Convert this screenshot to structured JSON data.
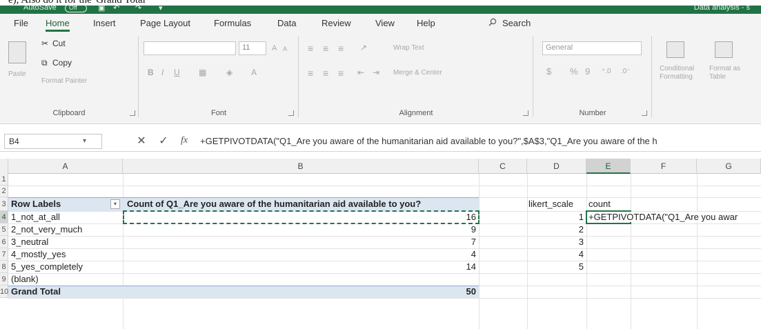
{
  "caption": "e), Also do it for the 'Grand Total'",
  "titlebar": {
    "autosave": "AutoSave",
    "autosave_state": "Off",
    "document_title": "Data analysis - s"
  },
  "tabs": [
    "File",
    "Home",
    "Insert",
    "Page Layout",
    "Formulas",
    "Data",
    "Review",
    "View",
    "Help"
  ],
  "search_label": "Search",
  "ribbon": {
    "clipboard": {
      "paste": "Paste",
      "cut": "Cut",
      "copy": "Copy",
      "format_painter": "Format Painter",
      "label": "Clipboard"
    },
    "font": {
      "size": "11",
      "grow": "A",
      "shrink": "A",
      "bold": "B",
      "italic": "I",
      "underline": "U",
      "label": "Font"
    },
    "alignment": {
      "wrap_text": "Wrap Text",
      "merge_center": "Merge & Center",
      "label": "Alignment"
    },
    "number": {
      "format": "General",
      "currency": "$",
      "percent": "%",
      "comma": "9",
      "label": "Number"
    },
    "styles": {
      "conditional": "Conditional Formatting",
      "format_as_table": "Format as Table"
    }
  },
  "formula_bar": {
    "name_box": "B4",
    "formula": "+GETPIVOTDATA(\"Q1_Are you aware of the humanitarian aid available to you?\",$A$3,\"Q1_Are you aware of the h"
  },
  "sheet": {
    "columns": [
      "A",
      "B",
      "C",
      "D",
      "E",
      "F",
      "G"
    ],
    "rows": [
      "1",
      "2",
      "3",
      "4",
      "5",
      "6",
      "7",
      "8",
      "9",
      "10"
    ],
    "pivot": {
      "header_labels": "Row Labels",
      "header_count": "Count of Q1_Are you aware of the humanitarian aid available to you?",
      "rows": [
        {
          "label": "1_not_at_all",
          "value": "16"
        },
        {
          "label": "2_not_very_much",
          "value": "9"
        },
        {
          "label": "3_neutral",
          "value": "7"
        },
        {
          "label": "4_mostly_yes",
          "value": "4"
        },
        {
          "label": "5_yes_completely",
          "value": "14"
        },
        {
          "label": "(blank)",
          "value": ""
        }
      ],
      "grand_total_label": "Grand Total",
      "grand_total_value": "50"
    },
    "side_table": {
      "header_scale": "likert_scale",
      "header_count": "count",
      "scale_values": [
        "1",
        "2",
        "3",
        "4",
        "5"
      ],
      "formula_preview": "+GETPIVOTDATA(\"Q1_Are you awar"
    }
  },
  "colors": {
    "accent": "#217346",
    "pivot_band": "#dce6f1",
    "ribbon_bg": "#f3f3f3"
  }
}
